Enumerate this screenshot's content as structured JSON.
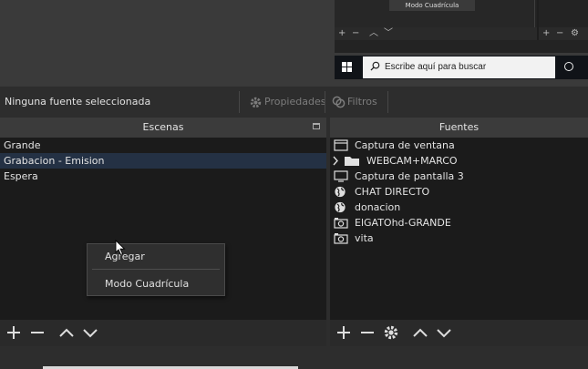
{
  "preview": {
    "tooltip": "Modo Cuadrícula"
  },
  "taskbar": {
    "search_placeholder": "Escribe aquí para buscar"
  },
  "info_bar": {
    "no_source": "Ninguna fuente seleccionada",
    "properties": "Propiedades",
    "filters": "Filtros"
  },
  "scenes": {
    "title": "Escenas",
    "items": [
      "Grande",
      "Grabacion - Emision",
      "Espera"
    ],
    "selected_index": 1
  },
  "sources": {
    "title": "Fuentes",
    "items": [
      {
        "label": "Captura de ventana",
        "icon": "window-icon"
      },
      {
        "label": "WEBCAM+MARCO",
        "icon": "folder-icon"
      },
      {
        "label": "Captura de pantalla 3",
        "icon": "monitor-icon"
      },
      {
        "label": "CHAT DIRECTO",
        "icon": "globe-icon"
      },
      {
        "label": "donacion",
        "icon": "globe-icon"
      },
      {
        "label": "ElGATOhd-GRANDE",
        "icon": "camera-icon"
      },
      {
        "label": "vita",
        "icon": "camera-icon"
      }
    ]
  },
  "context_menu": {
    "items": [
      "Agregar",
      "Modo Cuadrícula"
    ]
  },
  "colors": {
    "selected_row": "#243144",
    "dock_bg": "#1b1b1b",
    "title_bg": "#3b3b3b"
  }
}
